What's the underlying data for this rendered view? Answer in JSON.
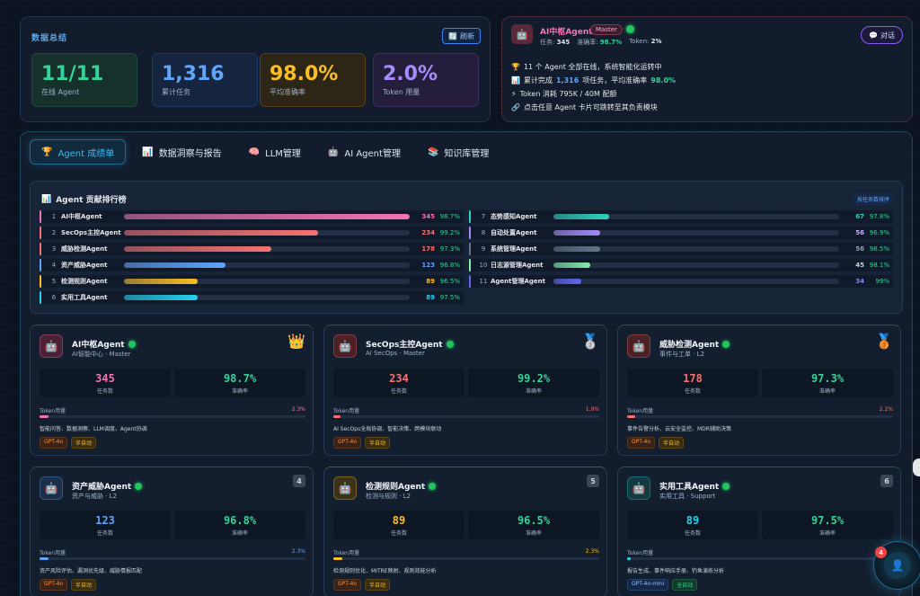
{
  "summary": {
    "title": "数据总结",
    "refresh_label": "刷新",
    "stats": [
      {
        "value": "11/11",
        "label": "在线 Agent"
      },
      {
        "value": "1,316",
        "label": "累计任务"
      },
      {
        "value": "98.0%",
        "label": "平均准确率"
      },
      {
        "value": "2.0%",
        "label": "Token 用量"
      }
    ]
  },
  "master": {
    "name": "AI中枢Agent",
    "badge": "Master",
    "tasks_label": "任务:",
    "tasks_value": "345",
    "acc_label": "准确率:",
    "acc_value": "98.7%",
    "token_label": "Token:",
    "token_value": "2%",
    "chat_label": "对话",
    "line1": "11 个 Agent 全部在线，系统智能化运转中",
    "line2_pre": "累计完成",
    "line2_tasks": "1,316",
    "line2_mid": "项任务，平均准确率",
    "line2_acc": "98.0%",
    "line3": "Token 消耗 795K / 40M 配额",
    "line4": "点击任意 Agent 卡片可跳转至其负责模块"
  },
  "tabs": [
    {
      "label": "Agent 成绩单",
      "icon": "🏆"
    },
    {
      "label": "数据洞察与报告",
      "icon": "📊"
    },
    {
      "label": "LLM管理",
      "icon": "🧠"
    },
    {
      "label": "AI Agent管理",
      "icon": "🤖"
    },
    {
      "label": "知识库管理",
      "icon": "📚"
    }
  ],
  "ranking": {
    "title": "Agent 贡献排行榜",
    "sort_label": "按任务数排序",
    "rows": [
      {
        "rank": "1",
        "name": "AI中枢Agent",
        "count": "345",
        "pct": "98.7%",
        "value": 345,
        "color": "#f472b6",
        "count_color": "#f472b6"
      },
      {
        "rank": "2",
        "name": "SecOps主控Agent",
        "count": "234",
        "pct": "99.2%",
        "value": 234,
        "color": "#f87171",
        "count_color": "#f87171"
      },
      {
        "rank": "3",
        "name": "威胁检测Agent",
        "count": "178",
        "pct": "97.3%",
        "value": 178,
        "color": "#f87171",
        "count_color": "#f87171"
      },
      {
        "rank": "4",
        "name": "资产威胁Agent",
        "count": "123",
        "pct": "96.8%",
        "value": 123,
        "color": "#60a5fa",
        "count_color": "#60a5fa"
      },
      {
        "rank": "5",
        "name": "检测规则Agent",
        "count": "89",
        "pct": "96.5%",
        "value": 89,
        "color": "#fbbf24",
        "count_color": "#fbbf24"
      },
      {
        "rank": "6",
        "name": "实用工具Agent",
        "count": "89",
        "pct": "97.5%",
        "value": 89,
        "color": "#22d3ee",
        "count_color": "#22d3ee"
      },
      {
        "rank": "7",
        "name": "态势感知Agent",
        "count": "67",
        "pct": "97.8%",
        "value": 67,
        "color": "#2dd4bf",
        "count_color": "#2dd4bf"
      },
      {
        "rank": "8",
        "name": "自动处置Agent",
        "count": "56",
        "pct": "96.9%",
        "value": 56,
        "color": "#a78bfa",
        "count_color": "#c4b5fd"
      },
      {
        "rank": "9",
        "name": "系统管理Agent",
        "count": "56",
        "pct": "96.5%",
        "value": 56,
        "color": "#64748b",
        "count_color": "#94a3b8"
      },
      {
        "rank": "10",
        "name": "日志源管理Agent",
        "count": "45",
        "pct": "98.1%",
        "value": 45,
        "color": "#86efac",
        "count_color": "#cbd5e1"
      },
      {
        "rank": "11",
        "name": "Agent管理Agent",
        "count": "34",
        "pct": "99%",
        "value": 34,
        "color": "#6366f1",
        "count_color": "#818cf8"
      }
    ],
    "max": 345
  },
  "cards": [
    {
      "name": "AI中枢Agent",
      "sub": "AI智能中心 · Master",
      "rank_mark": "👑",
      "tasks": "345",
      "tasks_label": "任务数",
      "acc": "98.7%",
      "acc_label": "准确率",
      "token_label": "Token用量",
      "token_pct": "2.3%",
      "token_value": 2.3,
      "desc": "智能问答、数据洞察、LLM调度、Agent协调",
      "model": "GPT-4o",
      "mode": "半自动",
      "accent": "#f472b6",
      "av_bg": "#4a2233"
    },
    {
      "name": "SecOps主控Agent",
      "sub": "AI SecOps · Master",
      "rank_mark": "🥈",
      "tasks": "234",
      "tasks_label": "任务数",
      "acc": "99.2%",
      "acc_label": "准确率",
      "token_label": "Token用量",
      "token_pct": "1.9%",
      "token_value": 1.9,
      "desc": "AI SecOps全局协调、智能决策、跨模块联动",
      "model": "GPT-4o",
      "mode": "半自动",
      "accent": "#f87171",
      "av_bg": "#4a2226"
    },
    {
      "name": "威胁检测Agent",
      "sub": "事件与工单 · L2",
      "rank_mark": "🥉",
      "tasks": "178",
      "tasks_label": "任务数",
      "acc": "97.3%",
      "acc_label": "准确率",
      "token_label": "Token用量",
      "token_pct": "2.2%",
      "token_value": 2.2,
      "desc": "事件告警分析、云安全监控、MDR辅助决策",
      "model": "GPT-4o",
      "mode": "半自动",
      "accent": "#f87171",
      "av_bg": "#4a2226"
    },
    {
      "name": "资产威胁Agent",
      "sub": "资产与威胁 · L2",
      "rank_mark": "4",
      "tasks": "123",
      "tasks_label": "任务数",
      "acc": "96.8%",
      "acc_label": "准确率",
      "token_label": "Token用量",
      "token_pct": "2.3%",
      "token_value": 2.3,
      "desc": "资产风险评估、漏洞优先级、威胁情报匹配",
      "model": "GPT-4o",
      "mode": "半自动",
      "accent": "#60a5fa",
      "av_bg": "#1c2f4a"
    },
    {
      "name": "检测规则Agent",
      "sub": "检测与规则 · L2",
      "rank_mark": "5",
      "tasks": "89",
      "tasks_label": "任务数",
      "acc": "96.5%",
      "acc_label": "准确率",
      "token_label": "Token用量",
      "token_pct": "2.3%",
      "token_value": 2.3,
      "desc": "检测规则优化、MITRE映射、规则效能分析",
      "model": "GPT-4o",
      "mode": "半自动",
      "accent": "#fbbf24",
      "av_bg": "#3a3318"
    },
    {
      "name": "实用工具Agent",
      "sub": "实用工具 · Support",
      "rank_mark": "6",
      "tasks": "89",
      "tasks_label": "任务数",
      "acc": "97.5%",
      "acc_label": "准确率",
      "token_label": "Token用量",
      "token_pct": "",
      "token_value": 1.0,
      "desc": "报告生成、事件响应手册、钓鱼演练分析",
      "model": "GPT-4o-mini",
      "mode": "全自动",
      "accent": "#22d3ee",
      "av_bg": "#143a40"
    }
  ],
  "fab": {
    "badge": "4"
  }
}
